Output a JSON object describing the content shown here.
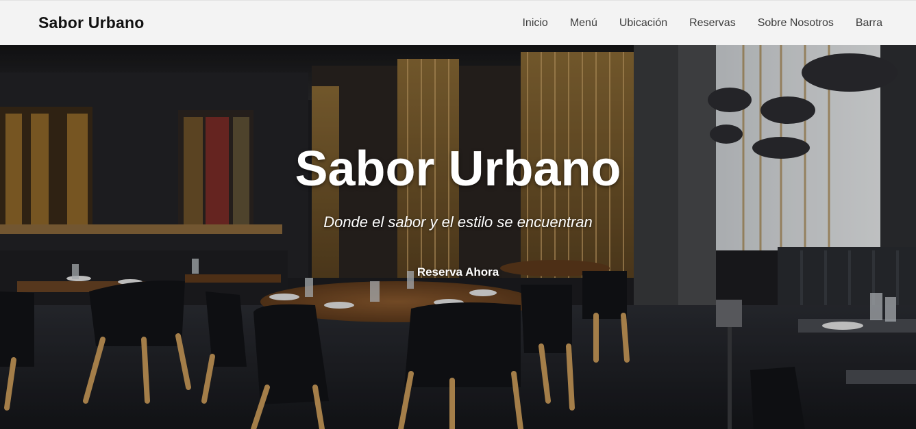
{
  "navbar": {
    "brand": "Sabor Urbano",
    "links": [
      "Inicio",
      "Menú",
      "Ubicación",
      "Reservas",
      "Sobre Nosotros",
      "Barra"
    ]
  },
  "hero": {
    "title": "Sabor Urbano",
    "subtitle": "Donde el sabor y el estilo se encuentran",
    "cta_label": "Reserva Ahora",
    "background_image": "restaurant-interior"
  },
  "colors": {
    "navbar_bg": "#f3f3f3",
    "brand_text": "#111111",
    "nav_text": "#3d3d3d",
    "hero_text": "#ffffff"
  }
}
